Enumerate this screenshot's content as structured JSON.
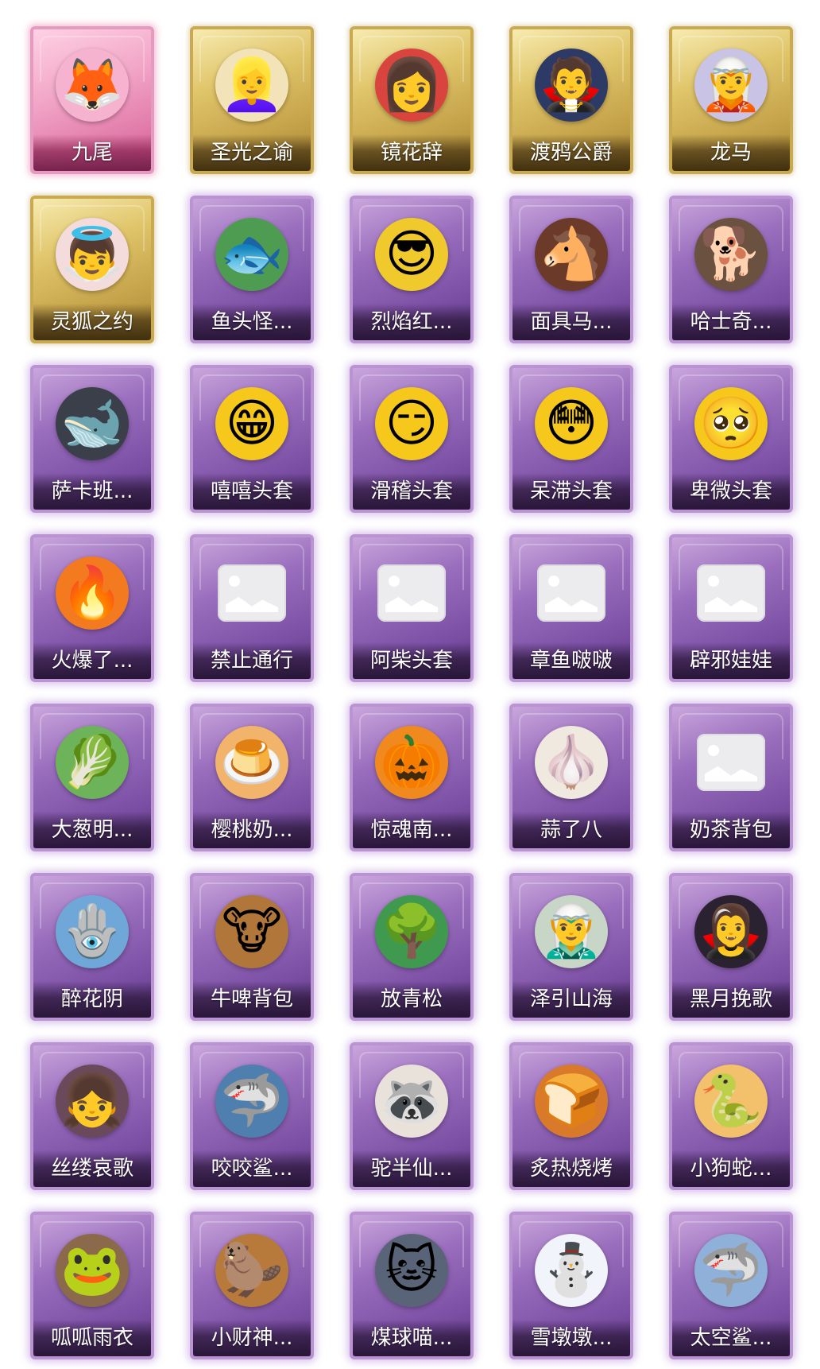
{
  "items": [
    {
      "label": "九尾",
      "rarity": "pink",
      "icon": "fox-girl-icon",
      "emoji": "🦊",
      "bg": "#f6b3d0"
    },
    {
      "label": "圣光之谕",
      "rarity": "gold",
      "icon": "blonde-girl-icon",
      "emoji": "👱‍♀️",
      "bg": "#f3e3b8"
    },
    {
      "label": "镜花辞",
      "rarity": "gold",
      "icon": "red-hood-girl-icon",
      "emoji": "👩",
      "bg": "#d9453e"
    },
    {
      "label": "渡鸦公爵",
      "rarity": "gold",
      "icon": "dark-prince-icon",
      "emoji": "🧛",
      "bg": "#2d3a66"
    },
    {
      "label": "龙马",
      "rarity": "gold",
      "icon": "white-hair-boy-icon",
      "emoji": "🧝",
      "bg": "#c9c3e6"
    },
    {
      "label": "灵狐之约",
      "rarity": "gold",
      "icon": "fox-spirit-icon",
      "emoji": "👼",
      "bg": "#f4dcdc"
    },
    {
      "label": "鱼头怪...",
      "rarity": "purple",
      "icon": "fish-head-icon",
      "emoji": "🐟",
      "bg": "#4e9b52"
    },
    {
      "label": "烈焰红...",
      "rarity": "purple",
      "icon": "pikachu-mask-icon",
      "emoji": "😎",
      "bg": "#f0c92c"
    },
    {
      "label": "面具马...",
      "rarity": "purple",
      "icon": "horse-mask-icon",
      "emoji": "🐴",
      "bg": "#6b3a28"
    },
    {
      "label": "哈士奇...",
      "rarity": "purple",
      "icon": "dog-sunglasses-icon",
      "emoji": "🐕",
      "bg": "#6a5140"
    },
    {
      "label": "萨卡班...",
      "rarity": "purple",
      "icon": "fish-sacabambaspis-icon",
      "emoji": "🐋",
      "bg": "#3a3f4a"
    },
    {
      "label": "嘻嘻头套",
      "rarity": "purple",
      "icon": "grin-emoji-icon",
      "emoji": "😁",
      "bg": "#f6c81c"
    },
    {
      "label": "滑稽头套",
      "rarity": "purple",
      "icon": "smirk-emoji-icon",
      "emoji": "😏",
      "bg": "#f6c81c"
    },
    {
      "label": "呆滞头套",
      "rarity": "purple",
      "icon": "stare-emoji-icon",
      "emoji": "😳",
      "bg": "#f6c81c"
    },
    {
      "label": "卑微头套",
      "rarity": "purple",
      "icon": "humble-emoji-icon",
      "emoji": "🥺",
      "bg": "#f6c81c"
    },
    {
      "label": "火爆了...",
      "rarity": "purple",
      "icon": "fire-face-icon",
      "emoji": "🔥",
      "bg": "#f37a1f"
    },
    {
      "label": "禁止通行",
      "rarity": "purple",
      "icon": "image-placeholder-icon",
      "emoji": "",
      "bg": ""
    },
    {
      "label": "阿柴头套",
      "rarity": "purple",
      "icon": "image-placeholder-icon",
      "emoji": "",
      "bg": ""
    },
    {
      "label": "章鱼啵啵",
      "rarity": "purple",
      "icon": "image-placeholder-icon",
      "emoji": "",
      "bg": ""
    },
    {
      "label": "辟邪娃娃",
      "rarity": "purple",
      "icon": "image-placeholder-icon",
      "emoji": "",
      "bg": ""
    },
    {
      "label": "大葱明...",
      "rarity": "purple",
      "icon": "scallion-icon",
      "emoji": "🥬",
      "bg": "#6db35a"
    },
    {
      "label": "樱桃奶...",
      "rarity": "purple",
      "icon": "pudding-icon",
      "emoji": "🍮",
      "bg": "#f2b36a"
    },
    {
      "label": "惊魂南...",
      "rarity": "purple",
      "icon": "pumpkin-icon",
      "emoji": "🎃",
      "bg": "#f08a1f"
    },
    {
      "label": "蒜了八",
      "rarity": "purple",
      "icon": "garlic-icon",
      "emoji": "🧄",
      "bg": "#efe9df"
    },
    {
      "label": "奶茶背包",
      "rarity": "purple",
      "icon": "image-placeholder-icon",
      "emoji": "",
      "bg": ""
    },
    {
      "label": "醉花阴",
      "rarity": "purple",
      "icon": "dreamcatcher-icon",
      "emoji": "🪬",
      "bg": "#6fa8d8"
    },
    {
      "label": "牛啤背包",
      "rarity": "purple",
      "icon": "cow-barrel-icon",
      "emoji": "🐮",
      "bg": "#b0763a"
    },
    {
      "label": "放青松",
      "rarity": "purple",
      "icon": "bonsai-tree-icon",
      "emoji": "🌳",
      "bg": "#3f9a4f"
    },
    {
      "label": "泽引山海",
      "rarity": "purple",
      "icon": "silver-hair-warrior-icon",
      "emoji": "🧝‍♂️",
      "bg": "#c8d6c8"
    },
    {
      "label": "黑月挽歌",
      "rarity": "purple",
      "icon": "gothic-girl-icon",
      "emoji": "🧛‍♀️",
      "bg": "#2a2230"
    },
    {
      "label": "丝缕哀歌",
      "rarity": "purple",
      "icon": "doll-girl-icon",
      "emoji": "👧",
      "bg": "#6a4a5a"
    },
    {
      "label": "咬咬鲨...",
      "rarity": "purple",
      "icon": "shark-icon",
      "emoji": "🦈",
      "bg": "#4f7fae"
    },
    {
      "label": "驼半仙...",
      "rarity": "purple",
      "icon": "raccoon-sunglasses-icon",
      "emoji": "🦝",
      "bg": "#e8e2da"
    },
    {
      "label": "炙热烧烤",
      "rarity": "purple",
      "icon": "bread-bone-icon",
      "emoji": "🍞",
      "bg": "#d97a2a"
    },
    {
      "label": "小狗蛇...",
      "rarity": "purple",
      "icon": "dog-snake-icon",
      "emoji": "🐍",
      "bg": "#f3c16b"
    },
    {
      "label": "呱呱雨衣",
      "rarity": "purple",
      "icon": "frog-hat-girl-icon",
      "emoji": "🐸",
      "bg": "#8a6a4a"
    },
    {
      "label": "小财神...",
      "rarity": "purple",
      "icon": "capybara-god-icon",
      "emoji": "🦫",
      "bg": "#b87a3a"
    },
    {
      "label": "煤球喵...",
      "rarity": "purple",
      "icon": "gray-cat-icon",
      "emoji": "🐱",
      "bg": "#5a6478"
    },
    {
      "label": "雪墩墩...",
      "rarity": "purple",
      "icon": "snowman-icon",
      "emoji": "⛄",
      "bg": "#f1f4fa"
    },
    {
      "label": "太空鲨...",
      "rarity": "purple",
      "icon": "space-shark-icon",
      "emoji": "🦈",
      "bg": "#8fb0d8"
    }
  ]
}
